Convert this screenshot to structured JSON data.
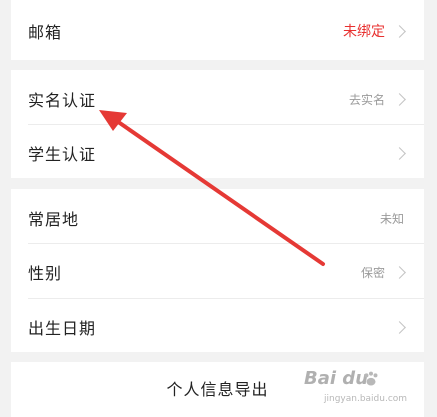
{
  "rows": {
    "email": {
      "label": "邮箱",
      "value": "未绑定"
    },
    "realname": {
      "label": "实名认证",
      "value": "去实名"
    },
    "student": {
      "label": "学生认证"
    },
    "residence": {
      "label": "常居地",
      "value": "未知"
    },
    "gender": {
      "label": "性别",
      "value": "保密"
    },
    "birthday": {
      "label": "出生日期"
    }
  },
  "footer": {
    "export_label": "个人信息导出"
  },
  "watermark": {
    "logo": "Bai du",
    "sub": "jingyan.baidu.com"
  },
  "colors": {
    "accent_red": "#e8302f",
    "arrow_red": "#e53935",
    "muted": "#9a9a9a",
    "background": "#f2f2f2"
  },
  "icons": [
    "chevron-right-icon",
    "red-arrow-annotation"
  ]
}
